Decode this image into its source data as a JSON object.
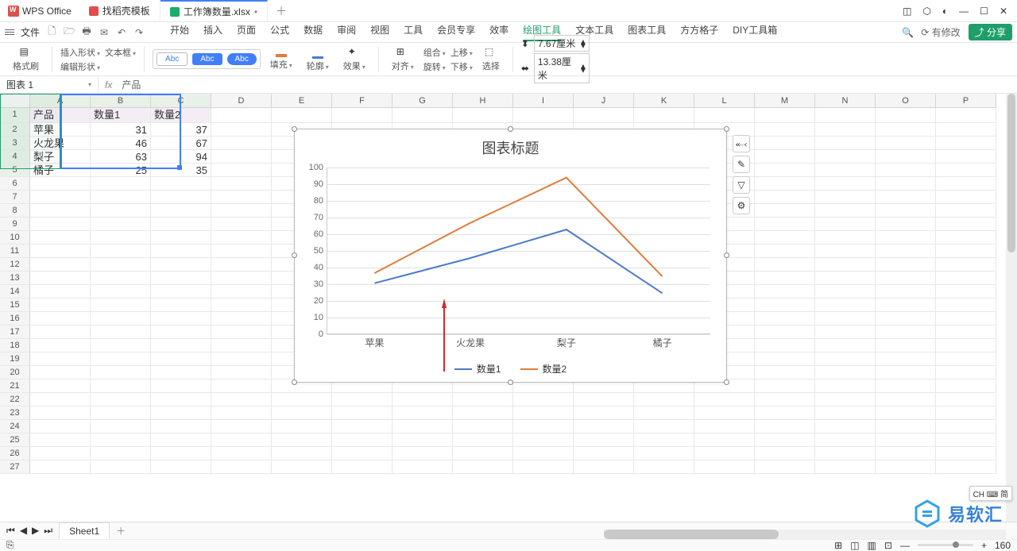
{
  "app": {
    "name": "WPS Office"
  },
  "tabs": [
    {
      "label": "找稻壳模板",
      "icon": "red"
    },
    {
      "label": "工作簿数量.xlsx",
      "icon": "green",
      "active": true,
      "dirty": "•"
    }
  ],
  "menu": {
    "file": "文件",
    "items": [
      "开始",
      "插入",
      "页面",
      "公式",
      "数据",
      "审阅",
      "视图",
      "工具",
      "会员专享",
      "效率",
      "绘图工具",
      "文本工具",
      "图表工具",
      "方方格子",
      "DIY工具箱"
    ],
    "active_index": 10,
    "modify": "⟳ 有修改",
    "share": "⤴ 分享"
  },
  "ribbon": {
    "fmt_brush": "格式刷",
    "insert_shape": "插入形状",
    "textbox": "文本框",
    "edit_shape": "编辑形状",
    "style_abc": "Abc",
    "fill": "填充",
    "outline": "轮廓",
    "effect": "效果",
    "align": "对齐",
    "group": "组合",
    "rotate": "旋转",
    "up": "上移",
    "down": "下移",
    "select": "选择",
    "w": "7.67厘米",
    "h": "13.38厘米",
    "w_ico": "⬍",
    "h_ico": "⬌"
  },
  "fbar": {
    "name": "图表 1",
    "fx": "fx",
    "content": "产品"
  },
  "cols": [
    "A",
    "B",
    "C",
    "D",
    "E",
    "F",
    "G",
    "H",
    "I",
    "J",
    "K",
    "L",
    "M",
    "N",
    "O",
    "P"
  ],
  "rows_count": 27,
  "table": {
    "headers": [
      "产品",
      "数量1",
      "数量2"
    ],
    "rows": [
      [
        "苹果",
        "31",
        "37"
      ],
      [
        "火龙果",
        "46",
        "67"
      ],
      [
        "梨子",
        "63",
        "94"
      ],
      [
        "橘子",
        "25",
        "35"
      ]
    ]
  },
  "chart_data": {
    "type": "line",
    "title": "图表标题",
    "categories": [
      "苹果",
      "火龙果",
      "梨子",
      "橘子"
    ],
    "series": [
      {
        "name": "数量1",
        "color": "#4a7bc8",
        "values": [
          31,
          46,
          63,
          25
        ]
      },
      {
        "name": "数量2",
        "color": "#e07b3c",
        "values": [
          37,
          67,
          94,
          35
        ]
      }
    ],
    "ylim": [
      0,
      100
    ],
    "ystep": 10
  },
  "chart_tools": [
    "⬷",
    "✎",
    "▽",
    "⚙"
  ],
  "sheet": {
    "name": "Sheet1"
  },
  "status": {
    "modes": [
      "⊞",
      "◫",
      "▥",
      "⊡"
    ],
    "zoom": "160",
    "sep": "—",
    "plus": "+"
  },
  "ime": "CH ⌨ 简",
  "watermark": "易软汇"
}
